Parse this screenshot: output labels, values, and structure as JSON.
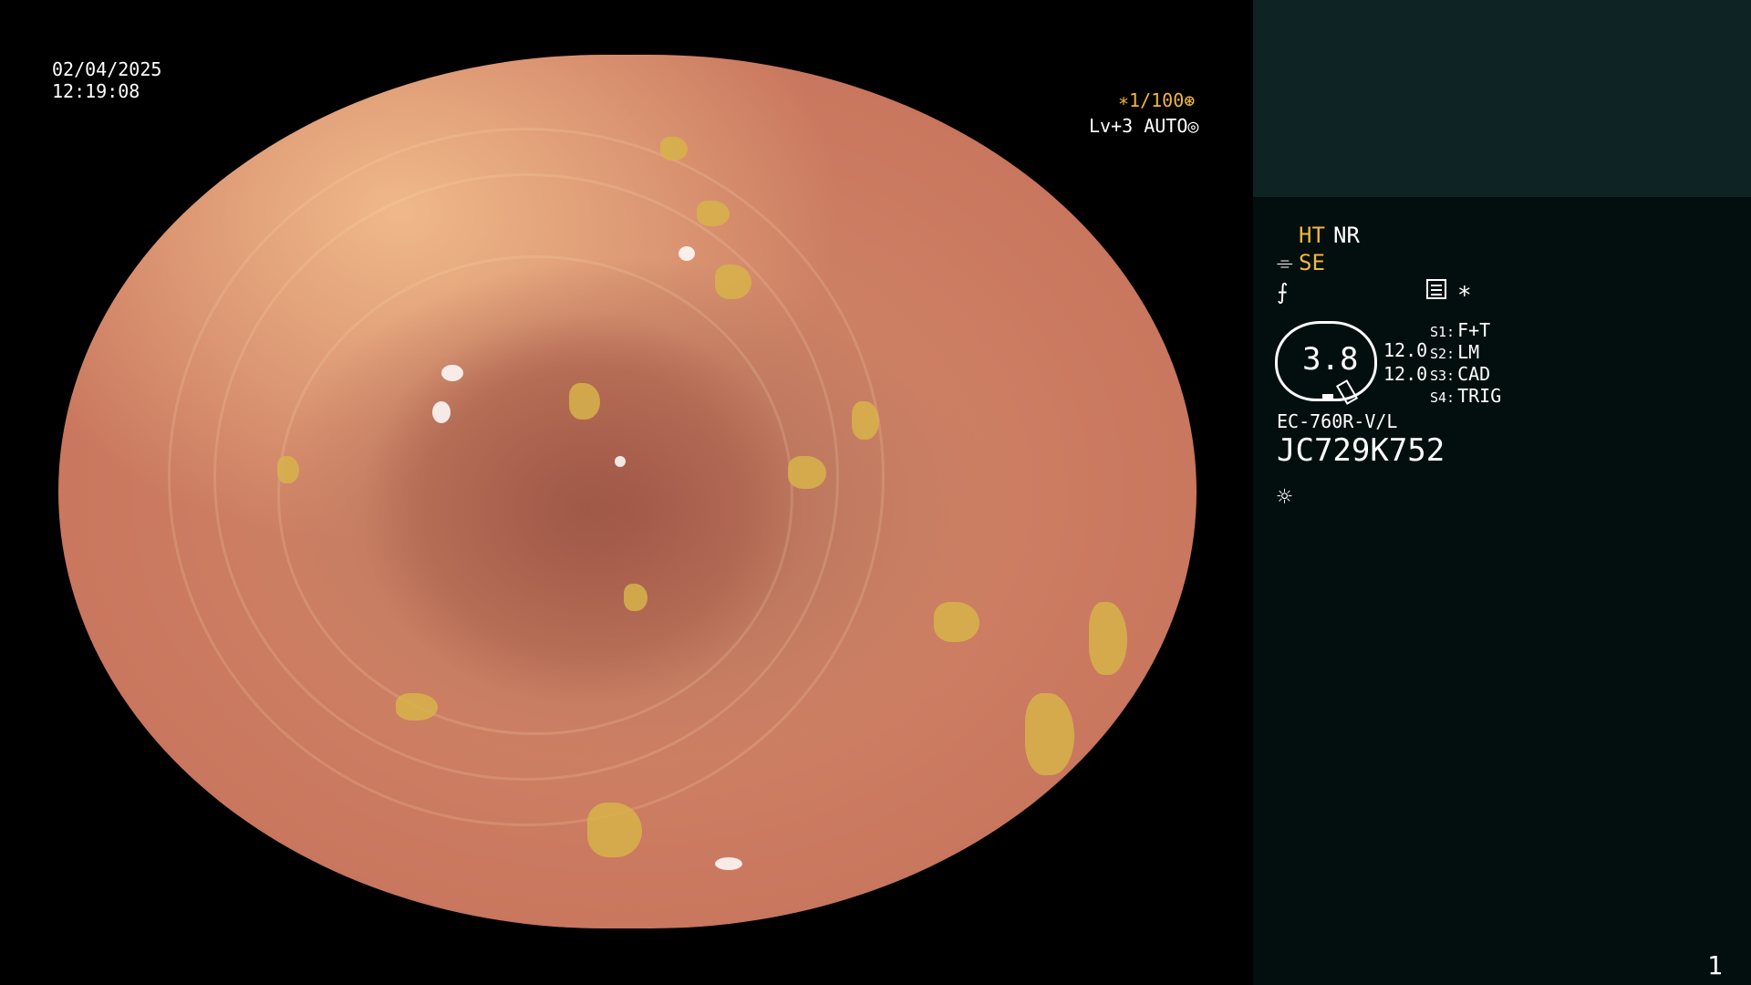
{
  "overlay": {
    "date": "02/04/2025",
    "time": "12:19:08",
    "zoom": "∗1/100⊛",
    "level": "Lv+3 AUTO◎"
  },
  "panel": {
    "ht": "HT",
    "nr": "NR",
    "se": "SE",
    "star": "∗",
    "gauge_value": "3.8",
    "value1": "12.0",
    "value2": "12.0",
    "settings": [
      {
        "key": "S1:",
        "value": "F+T"
      },
      {
        "key": "S2:",
        "value": "LM"
      },
      {
        "key": "S3:",
        "value": "CAD"
      },
      {
        "key": "S4:",
        "value": "TRIG"
      }
    ],
    "scope_model": "EC-760R-V/L",
    "serial": "JC729K752",
    "page_number": "1"
  },
  "icons": [
    "scope-icon",
    "fx-icon",
    "document-icon",
    "sun-icon"
  ]
}
